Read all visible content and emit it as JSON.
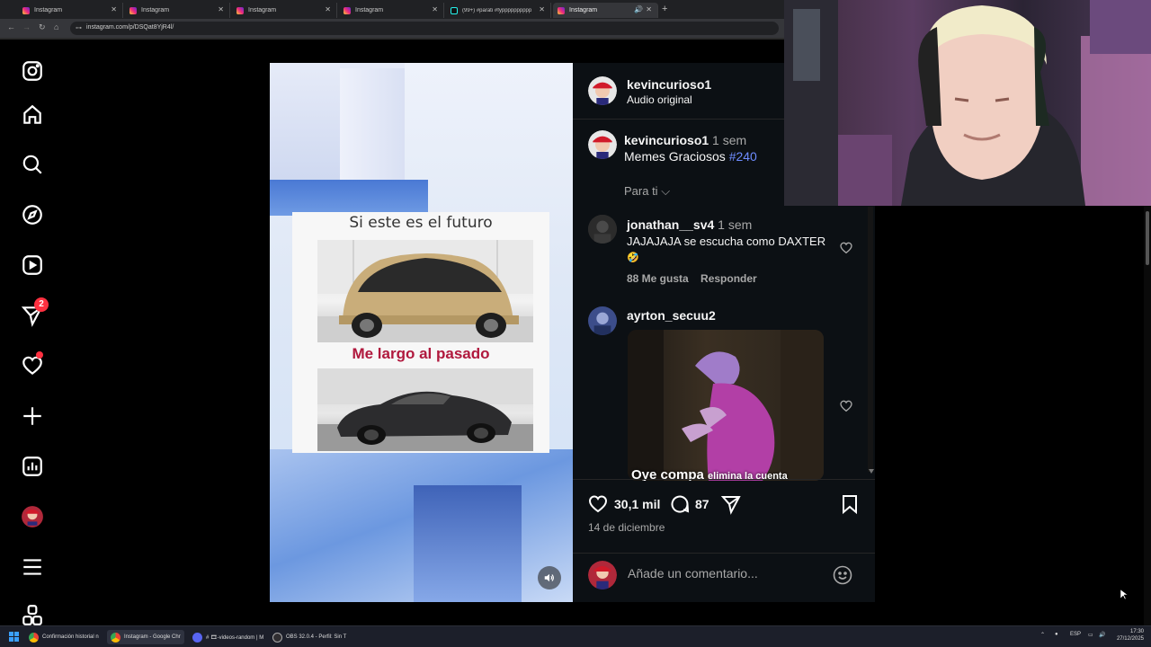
{
  "browser": {
    "tabs": [
      {
        "label": "Instagram",
        "favicon": "instagram-icon"
      },
      {
        "label": "Instagram",
        "favicon": "instagram-icon"
      },
      {
        "label": "Instagram",
        "favicon": "instagram-icon"
      },
      {
        "label": "Instagram",
        "favicon": "instagram-icon"
      },
      {
        "label": "(99+) #parati #fypppppppppp",
        "favicon": "tiktok-icon"
      },
      {
        "label": "Instagram",
        "favicon": "instagram-icon",
        "active": true
      }
    ],
    "url": "instagram.com/p/DSQat8YjR4l/"
  },
  "sidenav": {
    "messages_badge": "2",
    "items": [
      "instagram-logo",
      "home",
      "search",
      "explore",
      "reels",
      "messages",
      "notifications",
      "create",
      "dashboard",
      "profile",
      "more",
      "meta-apps"
    ]
  },
  "media": {
    "meme_top": "Si este es el futuro",
    "meme_middle": "Me largo al pasado"
  },
  "post": {
    "author": "kevincurioso1",
    "audio": "Audio original",
    "caption_user": "kevincurioso1",
    "caption_time": "1 sem",
    "caption_text": "Memes Graciosos ",
    "caption_hashtag": "#240",
    "filter": "Para ti",
    "comments": [
      {
        "user": "jonathan__sv4",
        "time": "1 sem",
        "text": "JAJAJAJA se escucha como DAXTER",
        "emoji": "🤣",
        "likes": "88 Me gusta",
        "reply": "Responder"
      },
      {
        "user": "ayrton_secuu2",
        "gif_caption": "Oye compa",
        "gif_caption_small": "elimina la cuenta"
      }
    ],
    "likes": "30,1 mil",
    "comments_count": "87",
    "date": "14 de diciembre",
    "comment_placeholder": "Añade un comentario..."
  },
  "taskbar": {
    "items": [
      "Confirmación historial n",
      "Instagram - Google Chr",
      "# 🎞-videos-random | M",
      "OBS 32.0.4 - Perfil: Sin T"
    ],
    "lang": "ESP",
    "time": "17:30",
    "date": "27/12/2025"
  }
}
